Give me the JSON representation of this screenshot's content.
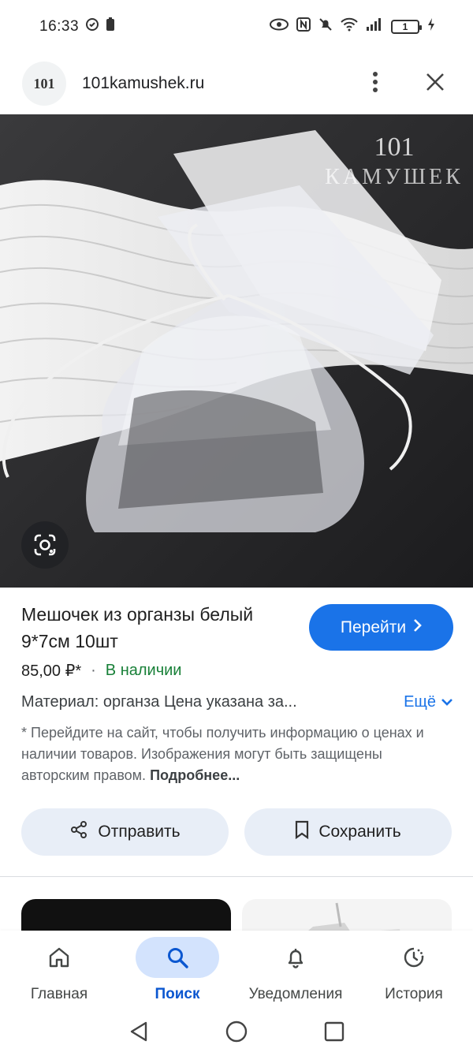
{
  "status_bar": {
    "time": "16:33",
    "battery_level": "1"
  },
  "header": {
    "site_logo_text": "101",
    "site_domain": "101kamushek.ru"
  },
  "hero": {
    "watermark_number": "101",
    "watermark_brand": "КАМУШЕК"
  },
  "product": {
    "title": "Мешочек из органзы белый 9*7см 10шт",
    "go_label": "Перейти",
    "price": "85,00 ₽*",
    "stock": "В наличии",
    "description": "Материал: органза Цена указана за...",
    "more_label": "Ещё",
    "disclaimer": "* Перейдите на сайт, чтобы получить информацию о ценах и наличии товаров. Изображения могут быть защищены авторским правом.",
    "disclaimer_link": "Подробнее..."
  },
  "actions": {
    "share_label": "Отправить",
    "save_label": "Сохранить"
  },
  "bottom_nav": {
    "items": [
      {
        "label": "Главная",
        "icon": "home-icon"
      },
      {
        "label": "Поиск",
        "icon": "search-icon",
        "active": true
      },
      {
        "label": "Уведомления",
        "icon": "bell-icon"
      },
      {
        "label": "История",
        "icon": "history-icon"
      }
    ]
  },
  "colors": {
    "accent": "#1a73e8",
    "stock_green": "#188038",
    "pill_bg": "#e8eef7",
    "active_nav_bg": "#d3e3fd"
  }
}
